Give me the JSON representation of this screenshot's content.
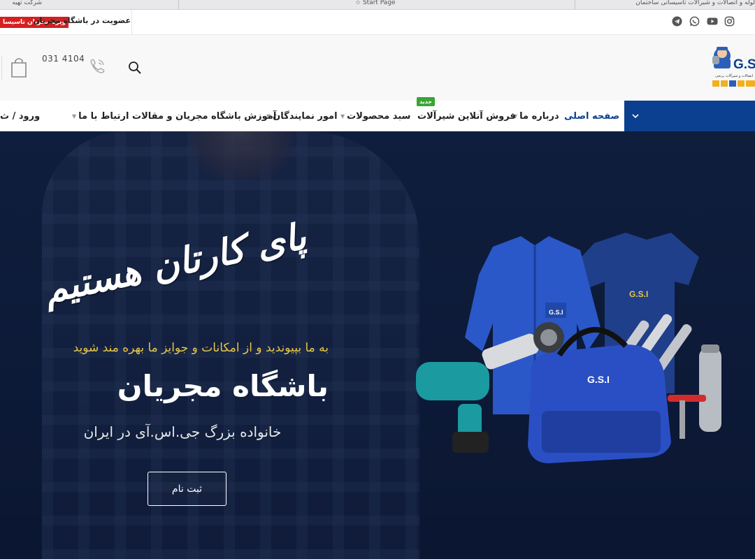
{
  "browser": {
    "tabs": [
      {
        "title": "شرکت تهیه"
      },
      {
        "title": "Start Page"
      },
      {
        "title": "لوله و اتصالات و شیرآلات تاسیساتی ساختمان"
      }
    ]
  },
  "topbar": {
    "social_icons": [
      "instagram-icon",
      "youtube-icon",
      "whatsapp-icon",
      "telegram-icon"
    ],
    "member_text": "عضویت در باشگاه مجریان",
    "member_badge": "ویژه مجریان تاسیسا"
  },
  "header": {
    "phone": "031 4104",
    "logo_text": "G.S.I",
    "logo_subtitle": "اتصالات و شیرآلات برنجی"
  },
  "nav": {
    "items": [
      {
        "label": "صفحه اصلی",
        "active": true,
        "has_caret": false
      },
      {
        "label": "درباره ما",
        "active": false,
        "has_caret": true
      },
      {
        "label": "فروش آنلاین شیرآلات",
        "active": false,
        "has_caret": false
      },
      {
        "label": "سبد محصولات",
        "active": false,
        "has_caret": true
      },
      {
        "label": "امور نمایندگان",
        "active": false,
        "has_caret": true
      },
      {
        "label": "آموزش باشگاه مجریان و مقالات",
        "active": false,
        "has_caret": true
      },
      {
        "label": "ارتباط با ما",
        "active": false,
        "has_caret": true
      },
      {
        "label": "ورود / ث",
        "active": false,
        "has_caret": false
      }
    ],
    "new_badge": "جدید"
  },
  "hero": {
    "calligraphy": "پای کارتان هستیم",
    "subtitle": "به ما بپیوندید و از امکانات و جوایز ما بهره مند شوید",
    "title": "باشگاه مجریان",
    "tagline": "خانواده بزرگ جی.اس.آی در ایران",
    "cta": "ثبت نام",
    "product_brand": "G.S.I"
  },
  "colors": {
    "nav_blue": "#0b3f8f",
    "badge_red": "#d61f1f",
    "badge_green": "#3aa335",
    "hero_gold": "#e6c64a"
  }
}
